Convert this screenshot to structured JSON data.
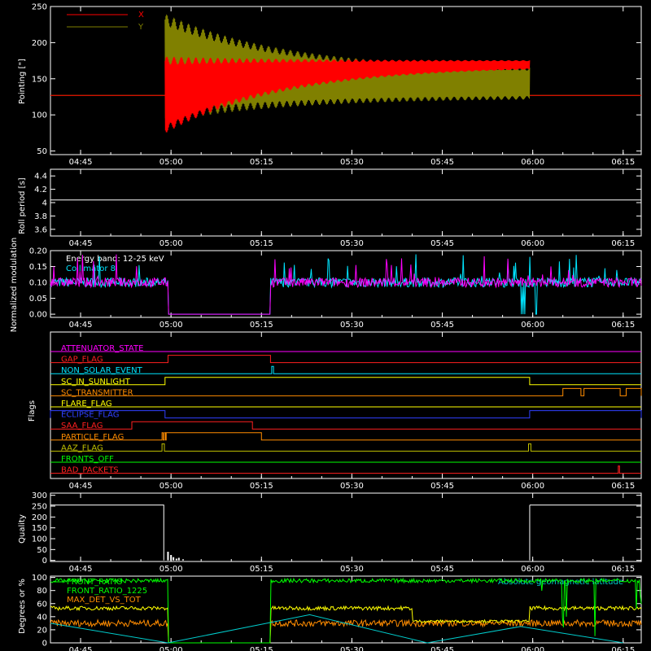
{
  "time_ticks": [
    "04:45",
    "05:00",
    "05:15",
    "05:30",
    "05:45",
    "06:00",
    "06:15"
  ],
  "time_tick_minutes": [
    285,
    300,
    315,
    330,
    345,
    360,
    375
  ],
  "time_range_minutes": [
    280,
    378
  ],
  "colors": {
    "background": "#000000",
    "axes": "#ffffff",
    "x_series": "#ff0000",
    "y_series": "#808000",
    "collimator": "#00e5ff",
    "modulation": "#ff00ff",
    "front_ratio": "#00ff00",
    "front_ratio_1225": "#ffff00",
    "max_det": "#ff8c00",
    "latitude": "#00cccc"
  },
  "chart_data": [
    {
      "type": "line",
      "ylabel": "Pointing [\"]",
      "ylim": [
        45,
        250
      ],
      "yticks": [
        50,
        100,
        150,
        200,
        250
      ],
      "legend_placement": "top-left",
      "series": [
        {
          "name": "X",
          "color": "#ff0000",
          "baseline": 127,
          "active_start": 299,
          "active_end": 359.5,
          "start_min": 80,
          "start_max": 175,
          "end_min": 168,
          "end_max": 175
        },
        {
          "name": "Y",
          "color": "#808000",
          "baseline": 127,
          "active_start": 299,
          "active_end": 359.5,
          "start_min": 98,
          "start_max": 232,
          "end_min": 125,
          "end_max": 160
        }
      ]
    },
    {
      "type": "line",
      "ylabel": "Roll period [s]",
      "ylim": [
        3.5,
        4.5
      ],
      "yticks": [
        3.6,
        3.8,
        4.0,
        4.2,
        4.4
      ],
      "series": [
        {
          "color": "#ffffff",
          "value": 4.04
        }
      ]
    },
    {
      "type": "line",
      "ylabel": "Normalized modulation",
      "ylim": [
        -0.01,
        0.2
      ],
      "yticks": [
        0.0,
        0.05,
        0.1,
        0.15,
        0.2
      ],
      "ytick_labels": [
        "0.00",
        "0.05",
        "0.10",
        "0.15",
        "0.20"
      ],
      "annotations": [
        "Energy band: 12-25 keV",
        "Collimator 8"
      ],
      "series": [
        {
          "color": "#00e5ff",
          "level": 0.1,
          "zero_start": 299.5,
          "zero_end": 316.5,
          "dips": [
            357.5,
            361
          ]
        },
        {
          "color": "#ff00ff",
          "level": 0.1,
          "zero_start": 299.5,
          "zero_end": 316.5
        }
      ]
    },
    {
      "type": "line",
      "ylabel": "Flags",
      "flags": [
        {
          "label": "ATTENUATOR_STATE",
          "color": "#ff00ff",
          "high": []
        },
        {
          "label": "GAP_FLAG",
          "color": "#ff2020",
          "high": [
            [
              299.5,
              316.5
            ]
          ]
        },
        {
          "label": "NON_SOLAR_EVENT",
          "color": "#00e5ff",
          "high": [
            [
              316.7,
              317
            ]
          ]
        },
        {
          "label": "SC_IN_SUNLIGHT",
          "color": "#ffff00",
          "high": [
            [
              299,
              359.5
            ]
          ]
        },
        {
          "label": "SC_TRANSMITTER",
          "color": "#ff8c00",
          "high": [
            [
              365,
              368
            ],
            [
              368.5,
              374.5
            ],
            [
              375.5,
              378
            ]
          ]
        },
        {
          "label": "FLARE_FLAG",
          "color": "#ffff00",
          "high": []
        },
        {
          "label": "ECLIPSE_FLAG",
          "color": "#3040ff",
          "high": [
            [
              280,
              299
            ],
            [
              359.5,
              378
            ]
          ]
        },
        {
          "label": "SAA_FLAG",
          "color": "#ff2020",
          "high": [
            [
              293.5,
              313.5
            ]
          ]
        },
        {
          "label": "PARTICLE_FLAG",
          "color": "#ff8c00",
          "high": [
            [
              298.5,
              298.7
            ],
            [
              298.9,
              299.1
            ],
            [
              299.2,
              315
            ]
          ]
        },
        {
          "label": "AAZ_FLAG",
          "color": "#c0c000",
          "high": [
            [
              298.5,
              298.9
            ],
            [
              359.3,
              359.7
            ]
          ]
        },
        {
          "label": "FRONTS_OFF",
          "color": "#00ff00",
          "high": []
        },
        {
          "label": "BAD_PACKETS",
          "color": "#ff2020",
          "high": [
            [
              374.2,
              374.4
            ]
          ]
        }
      ]
    },
    {
      "type": "line",
      "ylabel": "Quality",
      "ylim": [
        -5,
        310
      ],
      "yticks": [
        0,
        50,
        100,
        150,
        200,
        250,
        300
      ],
      "series": [
        {
          "color": "#ffffff",
          "segments": [
            [
              280,
              298.8,
              255
            ],
            [
              359.5,
              378,
              255
            ]
          ],
          "spikes": [
            [
              299.5,
              40
            ],
            [
              300,
              25
            ],
            [
              300.4,
              15
            ],
            [
              300.9,
              8
            ],
            [
              301.3,
              12
            ],
            [
              302,
              5
            ]
          ]
        }
      ]
    },
    {
      "type": "line",
      "ylabel": "Degrees or %",
      "ylim": [
        0,
        102
      ],
      "yticks": [
        0,
        20,
        40,
        60,
        80,
        100
      ],
      "legend_placement": "top-left",
      "series": [
        {
          "name": "FRONT_RATIO",
          "color": "#00ff00",
          "level": 95
        },
        {
          "name": "FRONT_RATIO_1225",
          "color": "#ffff00",
          "level": 53
        },
        {
          "name": "MAX_DET_VS_TOT",
          "color": "#ff8c00",
          "level": 30
        },
        {
          "name": "Absolute geomagnetic latitude",
          "color": "#00cccc",
          "peaks": [
            [
              280,
              30
            ],
            [
              299.5,
              0
            ],
            [
              323,
              43
            ],
            [
              342.5,
              0
            ],
            [
              358,
              25
            ],
            [
              375,
              0
            ]
          ]
        }
      ]
    }
  ]
}
